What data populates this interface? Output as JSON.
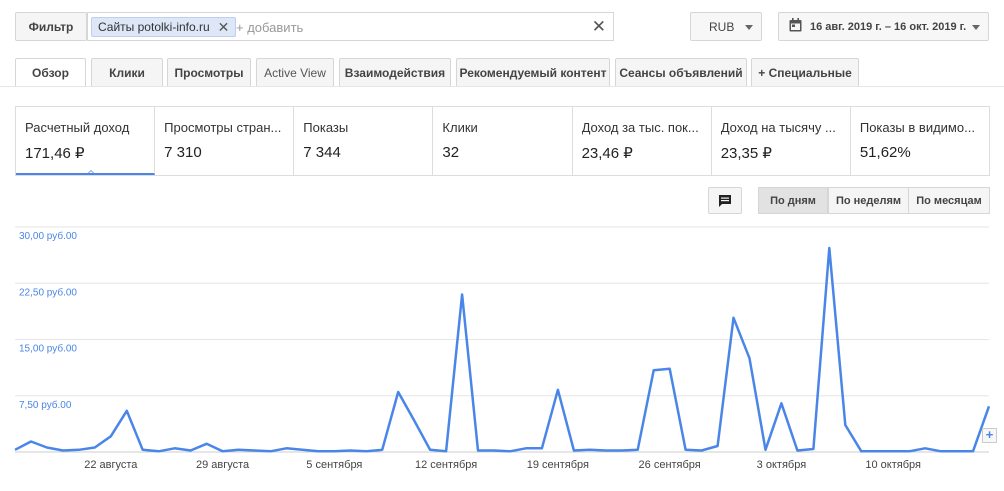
{
  "filter": {
    "button_label": "Фильтр",
    "chip_label": "Сайты potolki-info.ru",
    "add_placeholder": "+ добавить"
  },
  "currency": "RUB",
  "date_range": "16 авг. 2019 г. – 16 окт. 2019 г.",
  "tabs": [
    {
      "label": "Обзор"
    },
    {
      "label": "Клики"
    },
    {
      "label": "Просмотры"
    },
    {
      "label": "Active View"
    },
    {
      "label": "Взаимодействия"
    },
    {
      "label": "Рекомендуемый контент"
    },
    {
      "label": "Сеансы объявлений"
    },
    {
      "label": "+ Специальные"
    }
  ],
  "metrics": [
    {
      "label": "Расчетный доход",
      "value": "171,46 ₽"
    },
    {
      "label": "Просмотры стран...",
      "value": "7 310"
    },
    {
      "label": "Показы",
      "value": "7 344"
    },
    {
      "label": "Клики",
      "value": "32"
    },
    {
      "label": "Доход за тыс. пок...",
      "value": "23,46 ₽"
    },
    {
      "label": "Доход на тысячу ...",
      "value": "23,35 ₽"
    },
    {
      "label": "Показы в видимо...",
      "value": "51,62%"
    }
  ],
  "period_buttons": [
    "По дням",
    "По неделям",
    "По месяцам"
  ],
  "colors": {
    "series": "#4a86e8",
    "grid": "#e6e6e6",
    "accent": "#4a86e8"
  },
  "icons": {
    "annotation": "comment-icon",
    "calendar": "calendar-icon",
    "clear": "close-icon",
    "chip_remove": "close-icon",
    "zoom": "plus-icon"
  },
  "chart_data": {
    "type": "line",
    "title": "",
    "ylabel": "",
    "xlabel": "",
    "ylim": [
      0,
      30
    ],
    "y_ticks": [
      "7,50 руб.00",
      "15,00 руб.00",
      "22,50 руб.00",
      "30,00 руб.00"
    ],
    "x_tick_labels": [
      "22 августа",
      "29 августа",
      "5 сентября",
      "12 сентября",
      "19 сентября",
      "26 сентября",
      "3 октября",
      "10 октября"
    ],
    "x": [
      "2019-08-16",
      "2019-08-17",
      "2019-08-18",
      "2019-08-19",
      "2019-08-20",
      "2019-08-21",
      "2019-08-22",
      "2019-08-23",
      "2019-08-24",
      "2019-08-25",
      "2019-08-26",
      "2019-08-27",
      "2019-08-28",
      "2019-08-29",
      "2019-08-30",
      "2019-08-31",
      "2019-09-01",
      "2019-09-02",
      "2019-09-03",
      "2019-09-04",
      "2019-09-05",
      "2019-09-06",
      "2019-09-07",
      "2019-09-08",
      "2019-09-09",
      "2019-09-10",
      "2019-09-11",
      "2019-09-12",
      "2019-09-13",
      "2019-09-14",
      "2019-09-15",
      "2019-09-16",
      "2019-09-17",
      "2019-09-18",
      "2019-09-19",
      "2019-09-20",
      "2019-09-21",
      "2019-09-22",
      "2019-09-23",
      "2019-09-24",
      "2019-09-25",
      "2019-09-26",
      "2019-09-27",
      "2019-09-28",
      "2019-09-29",
      "2019-09-30",
      "2019-10-01",
      "2019-10-02",
      "2019-10-03",
      "2019-10-04",
      "2019-10-05",
      "2019-10-06",
      "2019-10-07",
      "2019-10-08",
      "2019-10-09",
      "2019-10-10",
      "2019-10-11",
      "2019-10-12",
      "2019-10-13",
      "2019-10-14",
      "2019-10-15",
      "2019-10-16"
    ],
    "series": [
      {
        "values": [
          0.3,
          1.4,
          0.6,
          0.2,
          0.3,
          0.6,
          2.1,
          5.5,
          0.3,
          0.1,
          0.5,
          0.2,
          1.1,
          0.1,
          0.3,
          0.2,
          0.1,
          0.5,
          0.3,
          0.1,
          0.1,
          0.2,
          0.1,
          0.3,
          8.0,
          4.2,
          0.3,
          0.1,
          21.0,
          0.2,
          0.2,
          0.1,
          0.5,
          0.5,
          8.3,
          0.2,
          0.3,
          0.2,
          0.2,
          0.3,
          10.9,
          11.1,
          0.3,
          0.2,
          0.8,
          17.9,
          12.5,
          0.3,
          6.5,
          0.2,
          0.4,
          27.2,
          3.6,
          0.1,
          0.1,
          0.1,
          0.1,
          0.5,
          0.1,
          0.1,
          0.1,
          6.1
        ]
      }
    ]
  }
}
